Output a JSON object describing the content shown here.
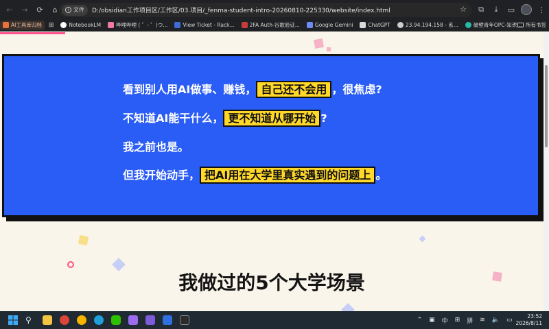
{
  "browser": {
    "site_chip_label": "文件",
    "url": "D:/obsidian工作项目区/工作区/03.项目/_fenma-student-intro-20260810-225330/website/index.html"
  },
  "bookmarks": [
    {
      "label": "AI工具库归档",
      "color": "#e8743b"
    },
    {
      "label": "NotebookLM",
      "color": "#ffffff"
    },
    {
      "label": "哔哩哔哩 ( ゜- ゜)つ...",
      "color": "#f07aa0"
    },
    {
      "label": "View Ticket - Rack...",
      "color": "#3d6bd8"
    },
    {
      "label": "2FA Auth-谷歌验证...",
      "color": "#c43c3c"
    },
    {
      "label": "Google Gemini",
      "color": "#6b8cf2"
    },
    {
      "label": "ChatGPT",
      "color": "#d9d9d9"
    },
    {
      "label": "23.94.194.158 - 系...",
      "color": "#cccccc"
    },
    {
      "label": "破壁青年OPC-知识...",
      "color": "#28b9a5"
    }
  ],
  "bookmarks_all_label": "所有书签",
  "hero": {
    "lines": [
      {
        "before": "看到别人用AI做事、赚钱，",
        "highlight": "自己还不会用",
        "after": "，很焦虑?"
      },
      {
        "before": "不知道AI能干什么，",
        "highlight": "更不知道从哪开始",
        "after": "?"
      },
      {
        "before": "我之前也是。",
        "highlight": "",
        "after": ""
      },
      {
        "before": "但我开始动手，",
        "highlight": "把AI用在大学里真实遇到的问题上",
        "after": "。"
      }
    ]
  },
  "section": {
    "title": "我做过的5个大学场景"
  },
  "taskbar": {
    "ime_lang": "中",
    "ime_mode": "拼",
    "time": "23:52",
    "date": "2026/8/11"
  }
}
